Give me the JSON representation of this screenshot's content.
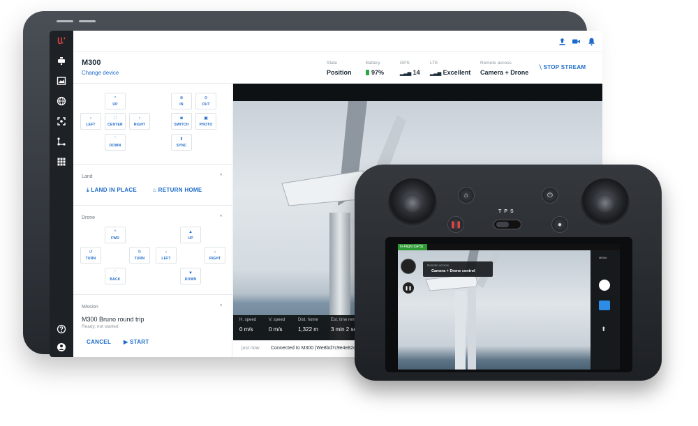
{
  "header": {
    "device_name": "M300",
    "change_device": "Change device",
    "state": {
      "label": "State",
      "value": "Position"
    },
    "battery": {
      "label": "Battery",
      "value": "97%"
    },
    "gps": {
      "label": "GPS",
      "value": "14"
    },
    "lte": {
      "label": "LTE",
      "value": "Excellent"
    },
    "remote_access": {
      "label": "Remote access",
      "value": "Camera + Drone"
    },
    "stop_stream": "STOP STREAM"
  },
  "camera_controls": {
    "gimbal": {
      "up": "UP",
      "left": "LEFT",
      "center": "CENTER",
      "right": "RIGHT",
      "down": "DOWN"
    },
    "zoom": {
      "in": "IN",
      "out": "OUT",
      "switch": "SWITCH",
      "photo": "PHOTO",
      "sync": "SYNC"
    }
  },
  "land": {
    "title": "Land",
    "land_in_place": "LAND IN PLACE",
    "return_home": "RETURN HOME"
  },
  "drone": {
    "title": "Drone",
    "fwd": "FWD",
    "turn_left": "TURN",
    "turn_right": "TURN",
    "back": "BACK",
    "up": "UP",
    "left": "LEFT",
    "right": "RIGHT",
    "down": "DOWN"
  },
  "mission": {
    "title": "Mission",
    "name": "M300 Bruno round trip",
    "status": "Ready, not started",
    "cancel": "CANCEL",
    "start": "START"
  },
  "telemetry": {
    "h_speed": {
      "label": "H. speed",
      "value": "0 m/s"
    },
    "v_speed": {
      "label": "V. speed",
      "value": "0 m/s"
    },
    "dist_home": {
      "label": "Dist. home",
      "value": "1,322 m"
    },
    "est_time": {
      "label": "Est. time remaining",
      "value": "3 min 2 sec"
    }
  },
  "status_bar": {
    "time": "just now",
    "message": "Connected to M300 (We8bd7c9e4e82de5)"
  },
  "controller": {
    "flight_mode": "In-Flight (GPS)",
    "remote_access_label": "Remote access",
    "remote_access_value": "Camera + Drone control",
    "tps": "TPS",
    "menu": "MENU"
  },
  "colors": {
    "accent": "#1b6ac9",
    "sidebar": "#1e2226",
    "ok": "#27a745"
  }
}
